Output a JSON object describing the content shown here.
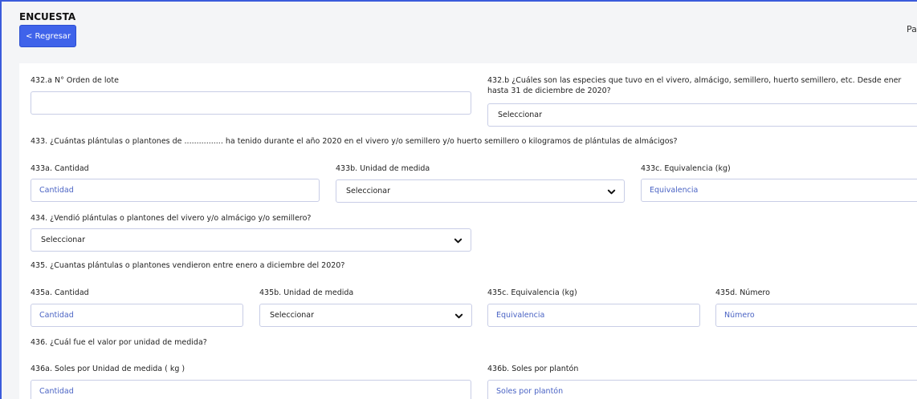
{
  "header": {
    "title": "ENCUESTA",
    "back_label": "< Regresar",
    "page_label": "Pa"
  },
  "form": {
    "q432a": {
      "label": "432.a N° Orden de lote",
      "value": ""
    },
    "q432b": {
      "label": "432.b ¿Cuáles son las especies que tuvo en el vivero, almácigo, semillero, huerto semillero, etc. Desde ener hasta 31 de diciembre de 2020?",
      "selected": "Seleccionar"
    },
    "q433": {
      "label": "433. ¿Cuántas plántulas o plantones de ................ ha tenido durante el año 2020 en el vivero y/o semillero y/o huerto semillero o kilogramos de plántulas de almácigos?",
      "a_label": "433a. Cantidad",
      "a_placeholder": "Cantidad",
      "b_label": "433b. Unidad de medida",
      "b_selected": "Seleccionar",
      "c_label": "433c. Equivalencia (kg)",
      "c_placeholder": "Equivalencia"
    },
    "q434": {
      "label": "434. ¿Vendió plántulas o plantones del vivero y/o almácigo y/o semillero?",
      "selected": "Seleccionar"
    },
    "q435": {
      "label": "435. ¿Cuantas plántulas o plantones vendieron entre enero a diciembre del 2020?",
      "a_label": "435a. Cantidad",
      "a_placeholder": "Cantidad",
      "b_label": "435b. Unidad de medida",
      "b_selected": "Seleccionar",
      "c_label": "435c. Equivalencia (kg)",
      "c_placeholder": "Equivalencia",
      "d_label": "435d. Número",
      "d_placeholder": "Número"
    },
    "q436": {
      "label": "436. ¿Cuál fue el valor por unidad de medida?",
      "a_label": "436a. Soles por Unidad de medida ( kg )",
      "a_placeholder": "Cantidad",
      "b_label": "436b. Soles por plantón",
      "b_placeholder": "Soles por plantón"
    }
  },
  "colors": {
    "accent": "#3f63ea",
    "field_text": "#4a63c4",
    "border": "#c8cde6"
  },
  "icons": {
    "select_arrow": "chevron-down-icon"
  }
}
